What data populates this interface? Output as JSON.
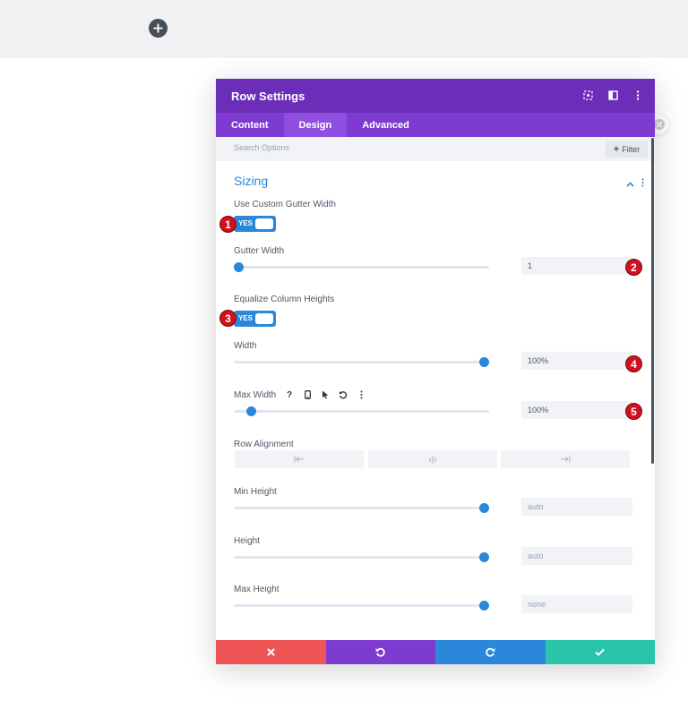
{
  "colors": {
    "header": "#6c2eb9",
    "tabs": "#7d3bcf",
    "active_tab": "#8f4fde",
    "accent": "#2b87da",
    "cancel": "#ef5555",
    "undo": "#7e3bd0",
    "redo": "#2b87da",
    "save": "#29c4a9",
    "badge": "#d0101f"
  },
  "modal": {
    "title": "Row Settings",
    "header_icons": [
      "expand-icon",
      "sidebar-icon",
      "more-vertical-icon"
    ]
  },
  "tabs": [
    {
      "label": "Content",
      "active": false
    },
    {
      "label": "Design",
      "active": true
    },
    {
      "label": "Advanced",
      "active": false
    }
  ],
  "search": {
    "placeholder": "Search Options",
    "filter_label": "Filter"
  },
  "section": {
    "title": "Sizing"
  },
  "fields": {
    "custom_gutter": {
      "label": "Use Custom Gutter Width",
      "toggle": "YES"
    },
    "gutter_width": {
      "label": "Gutter Width",
      "value": "1",
      "slider_fraction": 0.0
    },
    "equalize": {
      "label": "Equalize Column Heights",
      "toggle": "YES"
    },
    "width": {
      "label": "Width",
      "value": "100%",
      "slider_fraction": 1.0
    },
    "max_width": {
      "label": "Max Width",
      "value": "100%",
      "slider_fraction": 0.05,
      "tool_icons": [
        "help-icon",
        "phone-icon",
        "cursor-icon",
        "reset-icon",
        "more-vertical-icon"
      ]
    },
    "row_alignment": {
      "label": "Row Alignment",
      "options": [
        "left-align-icon",
        "center-align-icon",
        "right-align-icon"
      ]
    },
    "min_height": {
      "label": "Min Height",
      "value": "auto",
      "slider_fraction": 1.0
    },
    "height": {
      "label": "Height",
      "value": "auto",
      "slider_fraction": 1.0
    },
    "max_height": {
      "label": "Max Height",
      "value": "none",
      "slider_fraction": 1.0
    }
  },
  "badges": [
    "1",
    "2",
    "3",
    "4",
    "5"
  ],
  "footer": [
    "close-icon",
    "undo-icon",
    "redo-icon",
    "check-icon"
  ]
}
